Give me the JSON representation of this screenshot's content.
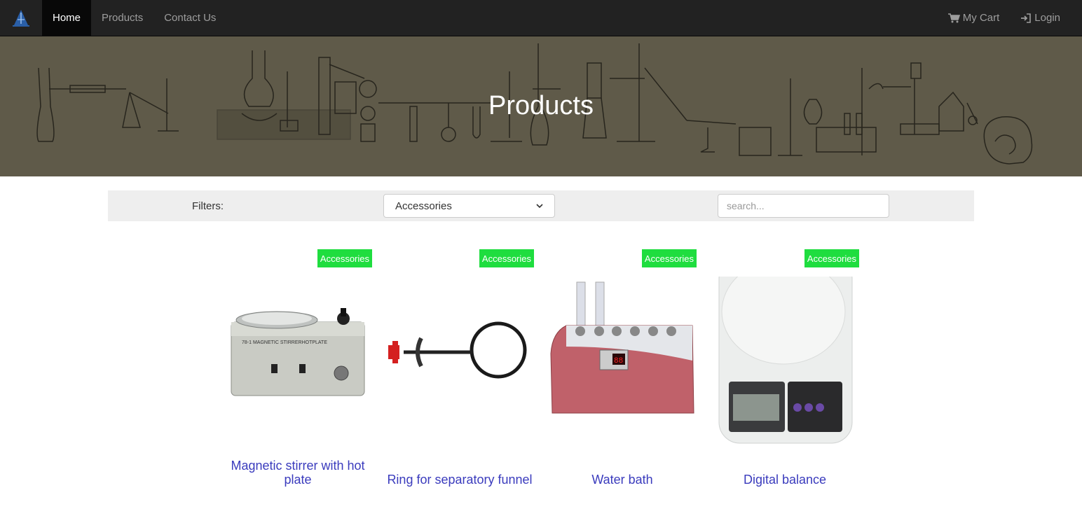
{
  "nav": {
    "items": [
      {
        "label": "Home",
        "active": true
      },
      {
        "label": "Products",
        "active": false
      },
      {
        "label": "Contact Us",
        "active": false
      }
    ],
    "cart_label": "My Cart",
    "login_label": "Login"
  },
  "hero": {
    "title": "Products"
  },
  "filters": {
    "label": "Filters:",
    "selected": "Accessories",
    "search_placeholder": "search..."
  },
  "products": [
    {
      "name": "Magnetic stirrer with hot plate",
      "category": "Accessories",
      "icon": "magnetic-stirrer-image"
    },
    {
      "name": "Ring for separatory funnel",
      "category": "Accessories",
      "icon": "ring-stand-image"
    },
    {
      "name": "Water bath",
      "category": "Accessories",
      "icon": "water-bath-image"
    },
    {
      "name": "Digital balance",
      "category": "Accessories",
      "icon": "digital-balance-image"
    }
  ],
  "colors": {
    "navbar": "#222222",
    "hero": "#5f5a49",
    "badge": "#1fdd3f",
    "product_link": "#3a3bbd"
  }
}
